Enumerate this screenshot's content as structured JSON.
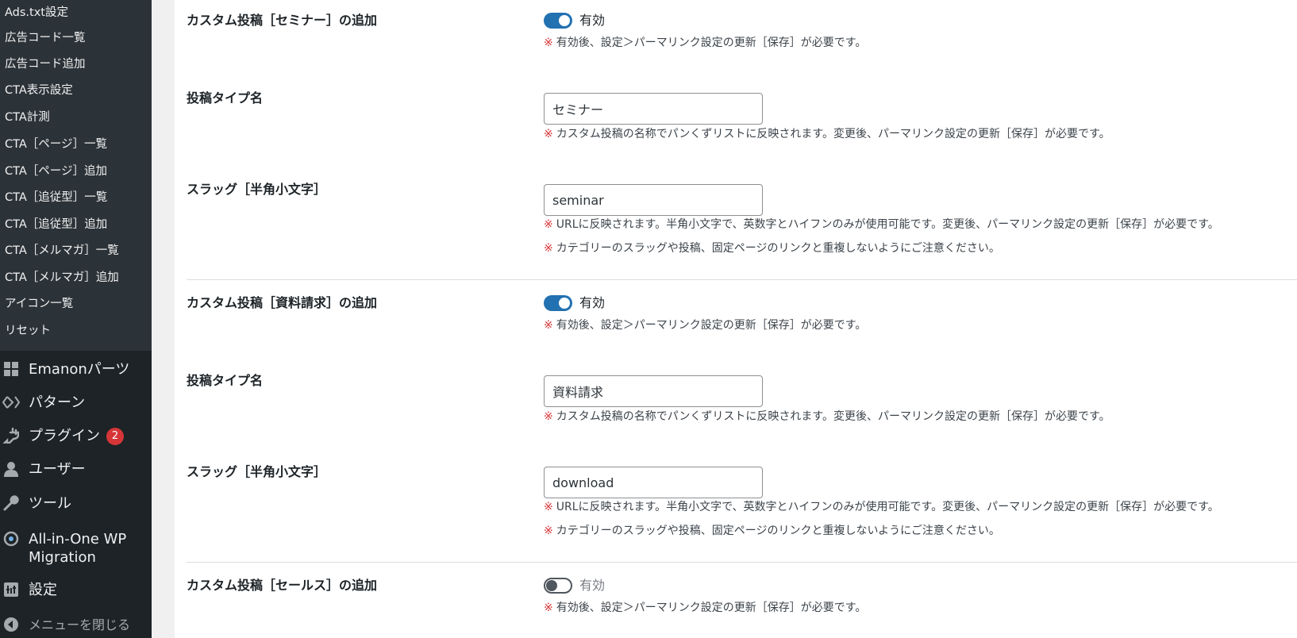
{
  "sidebar": {
    "submenu": [
      {
        "label": "Ads.txt設定"
      },
      {
        "label": "広告コード一覧"
      },
      {
        "label": "広告コード追加"
      },
      {
        "label": "CTA表示設定"
      },
      {
        "label": "CTA計測"
      },
      {
        "label": "CTA［ページ］一覧"
      },
      {
        "label": "CTA［ページ］追加"
      },
      {
        "label": "CTA［追従型］一覧"
      },
      {
        "label": "CTA［追従型］追加"
      },
      {
        "label": "CTA［メルマガ］一覧"
      },
      {
        "label": "CTA［メルマガ］追加"
      },
      {
        "label": "アイコン一覧"
      },
      {
        "label": "リセット"
      }
    ],
    "menu": [
      {
        "label": "Emanonパーツ",
        "icon": "grid-icon"
      },
      {
        "label": "パターン",
        "icon": "diamond-icon"
      },
      {
        "label": "プラグイン",
        "icon": "plug-icon",
        "badge": "2"
      },
      {
        "label": "ユーザー",
        "icon": "user-icon"
      },
      {
        "label": "ツール",
        "icon": "wrench-icon"
      },
      {
        "label": "All-in-One WP",
        "label2": "Migration",
        "icon": "migration-icon"
      },
      {
        "label": "設定",
        "icon": "settings-icon"
      },
      {
        "label": "メニューを閉じる",
        "icon": "collapse-icon"
      }
    ]
  },
  "content": {
    "sections": [
      {
        "enable_label": "カスタム投稿［セミナー］の追加",
        "toggle_on": true,
        "toggle_text": "有効",
        "toggle_note": "有効後、設定＞パーマリンク設定の更新［保存］が必要です。",
        "type_label": "投稿タイプ名",
        "type_value": "セミナー",
        "type_note": "カスタム投稿の名称でパンくずリストに反映されます。変更後、パーマリンク設定の更新［保存］が必要です。",
        "slug_label": "スラッグ［半角小文字］",
        "slug_value": "seminar",
        "slug_note1": "URLに反映されます。半角小文字で、英数字とハイフンのみが使用可能です。変更後、パーマリンク設定の更新［保存］が必要です。",
        "slug_note2": "カテゴリーのスラッグや投稿、固定ページのリンクと重複しないようにご注意ください。"
      },
      {
        "enable_label": "カスタム投稿［資料請求］の追加",
        "toggle_on": true,
        "toggle_text": "有効",
        "toggle_note": "有効後、設定＞パーマリンク設定の更新［保存］が必要です。",
        "type_label": "投稿タイプ名",
        "type_value": "資料請求",
        "type_note": "カスタム投稿の名称でパンくずリストに反映されます。変更後、パーマリンク設定の更新［保存］が必要です。",
        "slug_label": "スラッグ［半角小文字］",
        "slug_value": "download",
        "slug_note1": "URLに反映されます。半角小文字で、英数字とハイフンのみが使用可能です。変更後、パーマリンク設定の更新［保存］が必要です。",
        "slug_note2": "カテゴリーのスラッグや投稿、固定ページのリンクと重複しないようにご注意ください。"
      },
      {
        "enable_label": "カスタム投稿［セールス］の追加",
        "toggle_on": false,
        "toggle_text": "有効",
        "toggle_note": "有効後、設定＞パーマリンク設定の更新［保存］が必要です。"
      }
    ],
    "note_mark": "※"
  },
  "colors": {
    "sidebar_bg": "#1d2327",
    "submenu_bg": "#2c3338",
    "accent": "#2271b1",
    "note_mark": "#d63638",
    "badge": "#d63638"
  }
}
